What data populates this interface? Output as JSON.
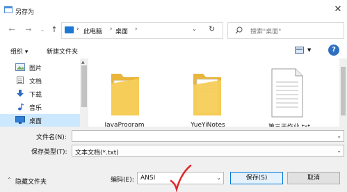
{
  "window": {
    "title": "另存为"
  },
  "nav": {
    "back_icon": "arrow-left-icon",
    "forward_icon": "arrow-right-icon",
    "recent_icon": "chevron-down-icon",
    "up_icon": "arrow-up-icon",
    "breadcrumb": [
      "此电脑",
      "桌面"
    ],
    "refresh_icon": "refresh-icon",
    "search_placeholder": "搜索\"桌面\""
  },
  "toolbar": {
    "organize": "组织 ▾",
    "new_folder": "新建文件夹"
  },
  "sidebar": {
    "items": [
      {
        "label": "图片",
        "icon": "pictures-icon"
      },
      {
        "label": "文档",
        "icon": "documents-icon"
      },
      {
        "label": "下载",
        "icon": "downloads-icon"
      },
      {
        "label": "音乐",
        "icon": "music-icon"
      },
      {
        "label": "桌面",
        "icon": "desktop-icon",
        "selected": true
      }
    ]
  },
  "files": [
    {
      "name": "JavaProgram",
      "type": "folder"
    },
    {
      "name": "YueYiNotes",
      "type": "folder"
    },
    {
      "name": "第三天作业.txt",
      "type": "text-file"
    }
  ],
  "form": {
    "filename_label": "文件名(N):",
    "filename_value": "",
    "filetype_label": "保存类型(T):",
    "filetype_value": "文本文档(*.txt)",
    "encoding_label": "编码(E):",
    "encoding_value": "ANSI"
  },
  "footer": {
    "hide_folders": "隐藏文件夹",
    "save": "保存(S)",
    "cancel": "取消"
  },
  "colors": {
    "accent": "#0078d7",
    "selection": "#cce8ff",
    "folder": "#f5c84c",
    "annotation": "#e0262a"
  }
}
